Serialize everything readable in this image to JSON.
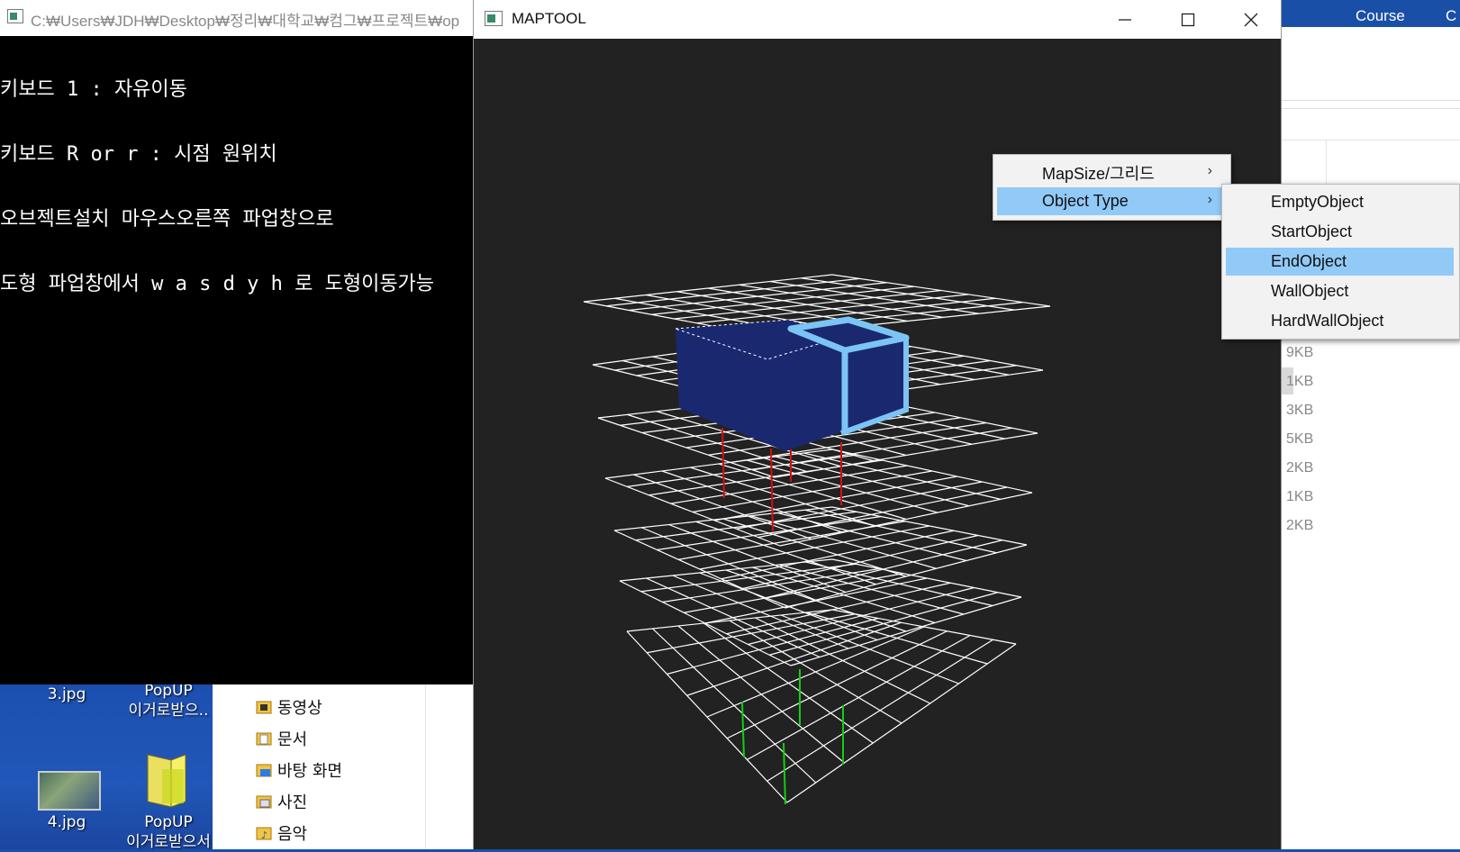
{
  "console": {
    "title": "C:₩Users₩JDH₩Desktop₩정리₩대학교₩컴그₩프로젝트₩op",
    "lines": [
      "키보드 1 : 자유이동",
      "키보드 R or r : 시점 원위치",
      "오브젝트설치 마우스오른쪽 파업창으로",
      "도형 파업창에서 w a s d y h 로 도형이동가능"
    ]
  },
  "maptool": {
    "title": "MAPTOOL",
    "colors": {
      "box_face": "#1a2870",
      "box_edge": "#7cc4f5",
      "grid": "#ffffff",
      "red_lines": "#d01010",
      "green_lines": "#10d010"
    }
  },
  "context_menu": {
    "items": [
      {
        "label": "MapSize/그리드"
      },
      {
        "label": "Object Type"
      }
    ]
  },
  "submenu": {
    "items": [
      {
        "label": "EmptyObject"
      },
      {
        "label": "StartObject"
      },
      {
        "label": "EndObject"
      },
      {
        "label": "WallObject"
      },
      {
        "label": "HardWallObject"
      }
    ],
    "selected": "EndObject"
  },
  "explorer": {
    "header_course": "Course",
    "header_c": "C",
    "sizes": [
      "9KB",
      "1KB",
      "3KB",
      "5KB",
      "2KB",
      "1KB",
      "2KB"
    ]
  },
  "desktop": {
    "icons": [
      {
        "label": "3.jpg",
        "icon": "image-icon"
      },
      {
        "label": "PopUP\n이거로받으..",
        "icon": "folder-icon"
      },
      {
        "label": "4.jpg",
        "icon": "image-icon"
      },
      {
        "label": "PopUP\n이거로받으서",
        "icon": "folder-icon"
      }
    ]
  },
  "navpane": {
    "items": [
      {
        "label": "동영상",
        "icon": "video-folder-icon"
      },
      {
        "label": "문서",
        "icon": "documents-folder-icon"
      },
      {
        "label": "바탕 화면",
        "icon": "desktop-folder-icon"
      },
      {
        "label": "사진",
        "icon": "pictures-folder-icon"
      },
      {
        "label": "음악",
        "icon": "music-folder-icon"
      }
    ]
  }
}
